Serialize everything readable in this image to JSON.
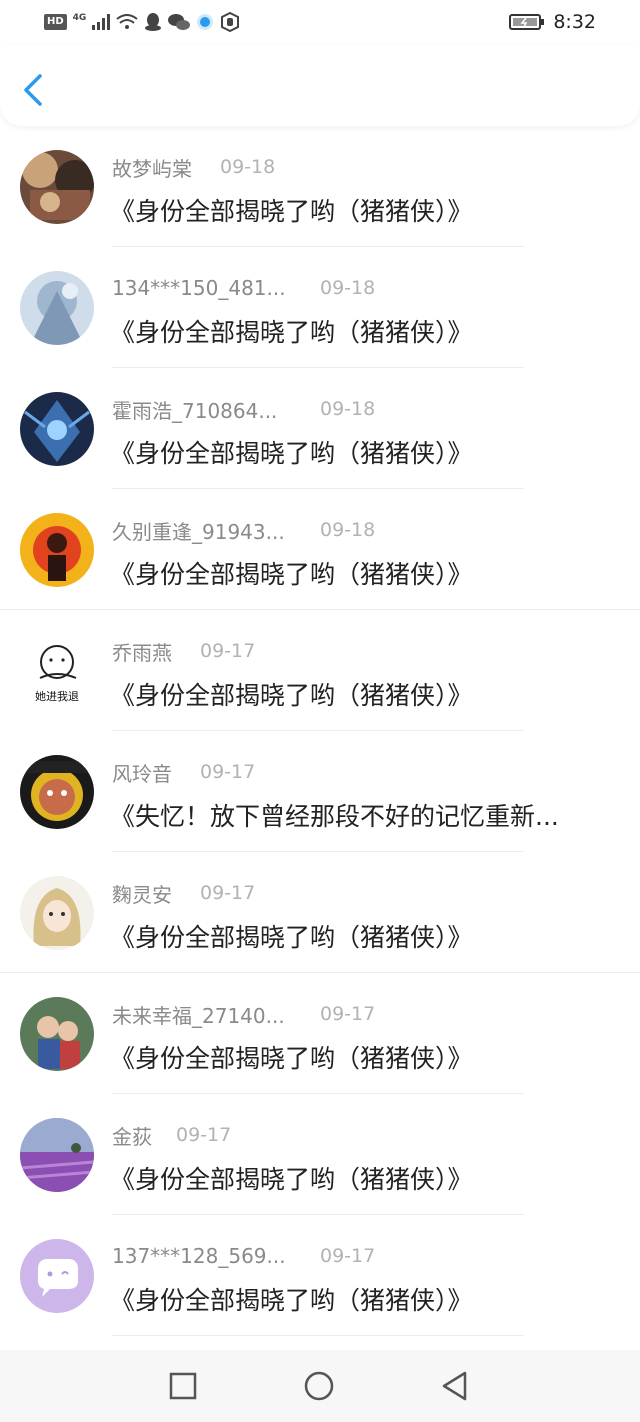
{
  "status_bar": {
    "hd": "HD",
    "network": "4G",
    "time": "8:32"
  },
  "header": {
    "back_icon": "chevron-left-icon"
  },
  "items": [
    {
      "name": "故梦屿棠",
      "date": "09-18",
      "title": "《身份全部揭晓了哟（猪猪侠）》"
    },
    {
      "name": "134***150_481...",
      "date": "09-18",
      "title": "《身份全部揭晓了哟（猪猪侠）》"
    },
    {
      "name": "霍雨浩_710864...",
      "date": "09-18",
      "title": "《身份全部揭晓了哟（猪猪侠）》"
    },
    {
      "name": "久别重逢_91943...",
      "date": "09-18",
      "title": "《身份全部揭晓了哟（猪猪侠）》"
    },
    {
      "name": "乔雨燕",
      "date": "09-17",
      "title": "《身份全部揭晓了哟（猪猪侠）》",
      "avatar_text": "她进我退"
    },
    {
      "name": "风玲音",
      "date": "09-17",
      "title": "《失忆！放下曾经那段不好的记忆重新..."
    },
    {
      "name": "麴灵安",
      "date": "09-17",
      "title": "《身份全部揭晓了哟（猪猪侠）》"
    },
    {
      "name": "未来幸福_27140...",
      "date": "09-17",
      "title": "《身份全部揭晓了哟（猪猪侠）》"
    },
    {
      "name": "金荻",
      "date": "09-17",
      "title": "《身份全部揭晓了哟（猪猪侠）》"
    },
    {
      "name": "137***128_569...",
      "date": "09-17",
      "title": "《身份全部揭晓了哟（猪猪侠）》"
    }
  ],
  "nav": {
    "recents": "square-icon",
    "home": "circle-icon",
    "back": "triangle-back-icon"
  },
  "colors": {
    "accent": "#2a9af0",
    "name_gray": "#8a8a8a",
    "date_gray": "#b2b2b2",
    "title": "#222222"
  }
}
